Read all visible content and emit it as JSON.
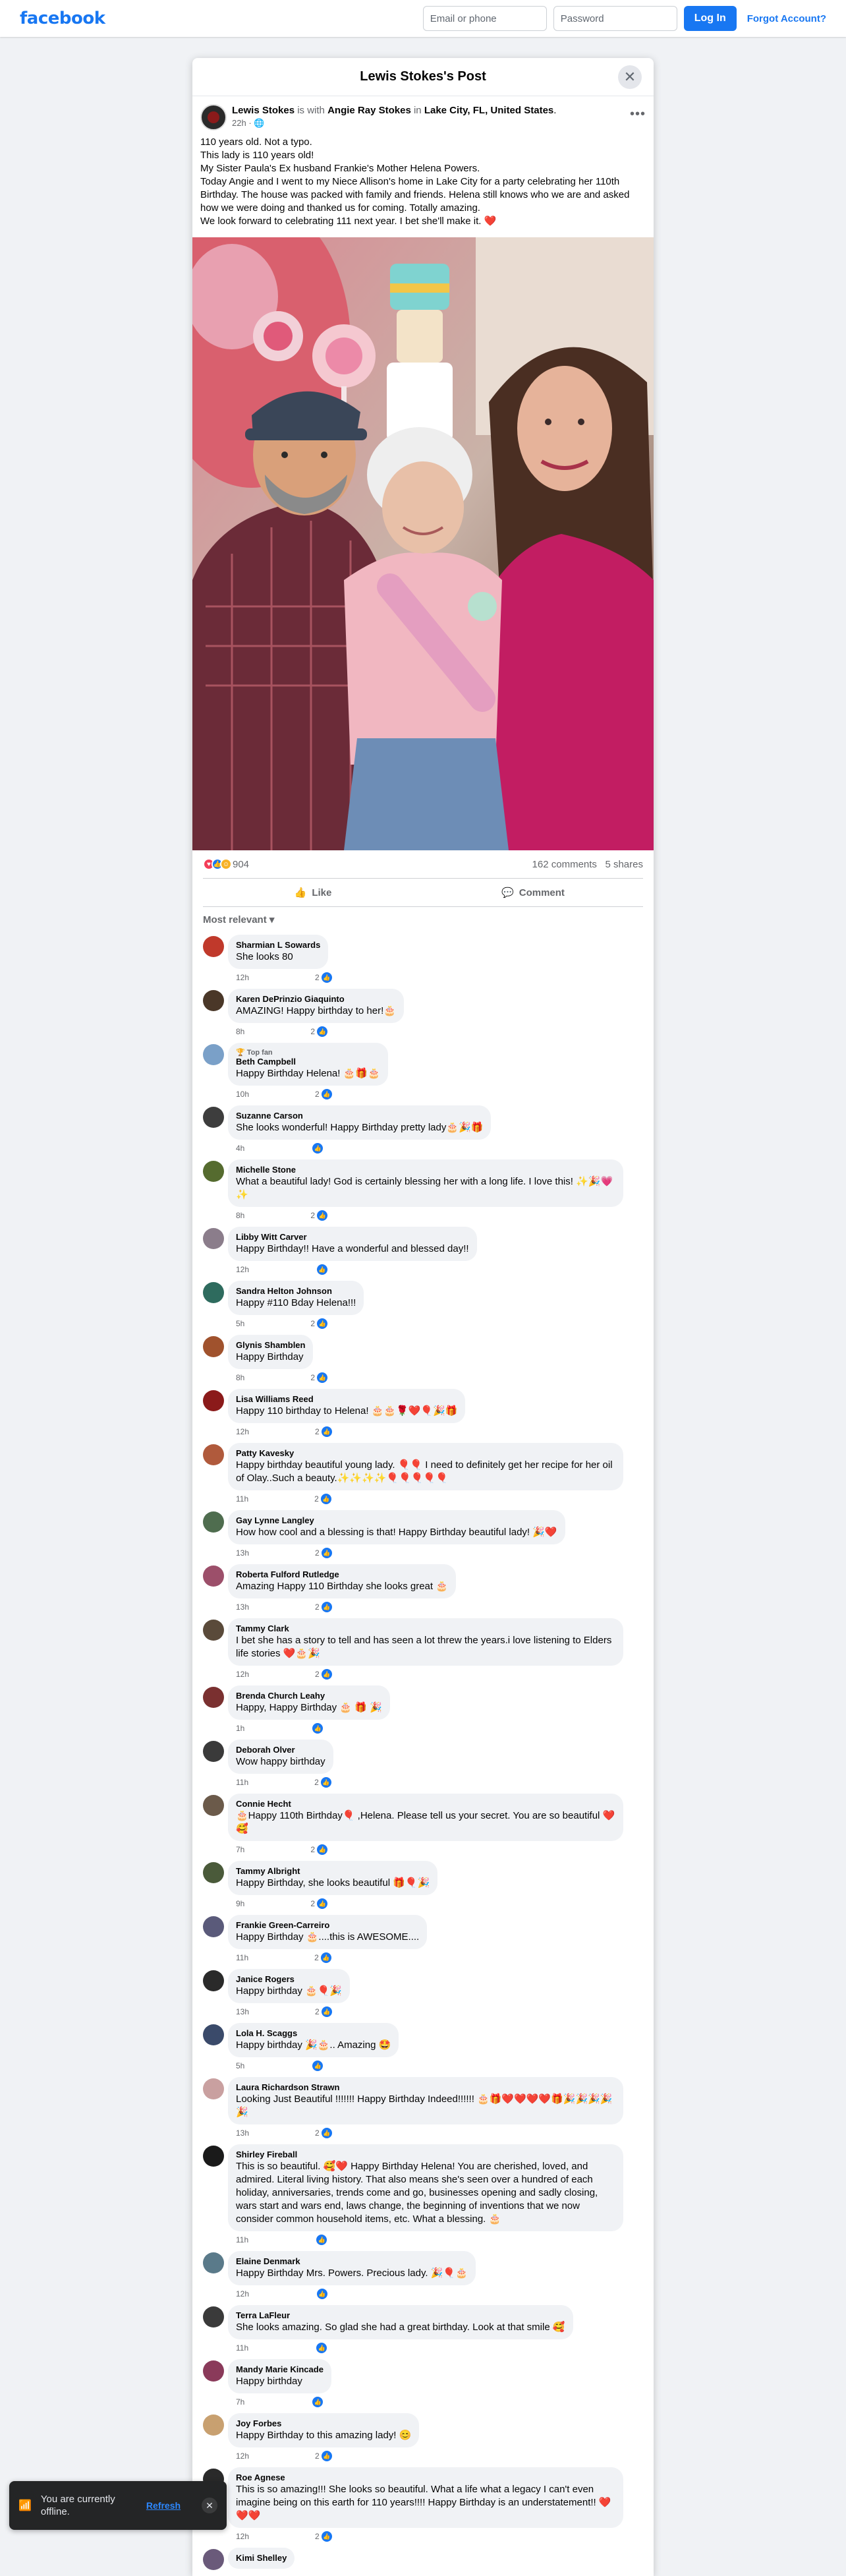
{
  "topbar": {
    "logo": "facebook",
    "email_placeholder": "Email or phone",
    "password_placeholder": "Password",
    "login_label": "Log In",
    "forgot_label": "Forgot Account?"
  },
  "modal": {
    "title": "Lewis Stokes's Post",
    "close_icon": "close-icon"
  },
  "post": {
    "author": "Lewis Stokes",
    "with_text": "is with",
    "tagged": "Angie Ray Stokes",
    "in_text": "in",
    "location": "Lake City, FL, United States",
    "end_punct": ".",
    "time": "22h",
    "privacy_icon": "globe-icon",
    "text_lines": [
      "110 years old. Not a typo.",
      "This lady is 110 years old!",
      "My Sister Paula's Ex husband Frankie's Mother Helena Powers.",
      "Today Angie and I went to my Niece Allison's home in Lake City for a party celebrating her 110th Birthday. The house was packed with family and friends. Helena still knows who we are and asked how we were doing and thanked us for coming.  Totally amazing.",
      "We look forward to celebrating 111 next year. I bet she'll make it. ❤️"
    ]
  },
  "stats": {
    "reaction_count": "904",
    "comments": "162 comments",
    "shares": "5 shares"
  },
  "actions": {
    "like": "Like",
    "comment": "Comment"
  },
  "sort_label": "Most relevant",
  "comments": [
    {
      "name": "Sharmian L Sowards",
      "text": "She looks 80",
      "time": "12h",
      "reacts": "2",
      "color": "#c0392b"
    },
    {
      "name": "Karen DePrinzio Giaquinto",
      "text": "AMAZING! Happy birthday to her!🎂",
      "time": "8h",
      "reacts": "2",
      "color": "#4a3728"
    },
    {
      "badge": "🏆 Top fan",
      "name": "Beth Campbell",
      "text": "Happy Birthday Helena! 🎂🎁🎂",
      "time": "10h",
      "reacts": "2",
      "color": "#7aa0c8"
    },
    {
      "name": "Suzanne Carson",
      "text": "She looks wonderful! Happy Birthday pretty lady🎂🎉🎁",
      "time": "4h",
      "reacts": "",
      "color": "#3d3d3d"
    },
    {
      "name": "Michelle Stone",
      "text": "What a beautiful lady! God is certainly blessing her with a long life. I love this! ✨🎉💗✨",
      "time": "8h",
      "reacts": "2",
      "color": "#556b2f"
    },
    {
      "name": "Libby Witt Carver",
      "text": "Happy Birthday!! Have a wonderful and blessed day!!",
      "time": "12h",
      "reacts": "",
      "color": "#8b7d8b"
    },
    {
      "name": "Sandra Helton Johnson",
      "text": "Happy #110 Bday Helena!!!",
      "time": "5h",
      "reacts": "2",
      "color": "#2e6b5e"
    },
    {
      "name": "Glynis Shamblen",
      "text": "Happy Birthday",
      "time": "8h",
      "reacts": "2",
      "color": "#a0522d"
    },
    {
      "name": "Lisa Williams Reed",
      "text": "Happy 110 birthday to Helena! 🎂🎂🌹❤️🎈🎉🎁",
      "time": "12h",
      "reacts": "2",
      "color": "#8b1a1a"
    },
    {
      "name": "Patty Kavesky",
      "text": "Happy birthday beautiful young lady. 🎈🎈 I need to definitely get her recipe for her oil of Olay..Such a beauty.✨✨✨✨🎈🎈🎈🎈🎈",
      "time": "11h",
      "reacts": "2",
      "color": "#b05a3c"
    },
    {
      "name": "Gay Lynne Langley",
      "text": "How how cool and a blessing is that! Happy Birthday beautiful lady! 🎉❤️",
      "time": "13h",
      "reacts": "2",
      "color": "#4f6d4f"
    },
    {
      "name": "Roberta Fulford Rutledge",
      "text": "Amazing Happy 110 Birthday she looks great 🎂",
      "time": "13h",
      "reacts": "2",
      "color": "#9c4f6a"
    },
    {
      "name": "Tammy Clark",
      "text": "I bet she has a story to tell and has seen a lot threw the years.i love listening to Elders life stories ❤️🎂🎉",
      "time": "12h",
      "reacts": "2",
      "color": "#5a4a3a"
    },
    {
      "name": "Brenda Church Leahy",
      "text": "Happy, Happy Birthday 🎂 🎁 🎉",
      "time": "1h",
      "reacts": "",
      "color": "#7a3030"
    },
    {
      "name": "Deborah Olver",
      "text": "Wow happy birthday",
      "time": "11h",
      "reacts": "2",
      "color": "#3a3a3a"
    },
    {
      "name": "Connie Hecht",
      "text": "🎂Happy 110th Birthday🎈 ,Helena. Please tell us your secret. You are so beautiful ❤️🥰",
      "time": "7h",
      "reacts": "2",
      "color": "#6b5a4a"
    },
    {
      "name": "Tammy Albright",
      "text": "Happy Birthday, she looks beautiful 🎁🎈🎉",
      "time": "9h",
      "reacts": "2",
      "color": "#4a5a3a"
    },
    {
      "name": "Frankie Green-Carreiro",
      "text": "Happy Birthday 🎂....this is AWESOME....",
      "time": "11h",
      "reacts": "2",
      "color": "#5a5a7a"
    },
    {
      "name": "Janice Rogers",
      "text": "Happy birthday 🎂🎈🎉",
      "time": "13h",
      "reacts": "2",
      "color": "#2a2a2a"
    },
    {
      "name": "Lola H. Scaggs",
      "text": "Happy birthday 🎉🎂.. Amazing 🤩",
      "time": "5h",
      "reacts": "",
      "color": "#3a4a6a"
    },
    {
      "name": "Laura Richardson Strawn",
      "text": "Looking Just Beautiful !!!!!!! Happy Birthday Indeed!!!!!! 🎂🎁❤️❤️❤️❤️🎁🎉🎉🎉🎉🎉",
      "time": "13h",
      "reacts": "2",
      "color": "#c9a0a0"
    },
    {
      "name": "Shirley Fireball",
      "text": "This is so beautiful. 🥰❤️ Happy Birthday Helena! You are cherished, loved, and admired. Literal living history. That also means she's seen over a hundred of each holiday, anniversaries, trends come and go, businesses opening and sadly closing, wars start and wars end, laws change, the beginning of inventions that we now consider common household items, etc. What a blessing. 🎂",
      "time": "11h",
      "reacts": "",
      "color": "#1a1a1a"
    },
    {
      "name": "Elaine Denmark",
      "text": "Happy Birthday Mrs. Powers. Precious lady. 🎉🎈🎂",
      "time": "12h",
      "reacts": "",
      "color": "#5a7a8a"
    },
    {
      "name": "Terra LaFleur",
      "text": "She looks amazing. So glad she had a great birthday. Look at that smile 🥰",
      "time": "11h",
      "reacts": "",
      "color": "#3a3a3a"
    },
    {
      "name": "Mandy Marie Kincade",
      "text": "Happy birthday",
      "time": "7h",
      "reacts": "",
      "color": "#8a3a5a"
    },
    {
      "name": "Joy Forbes",
      "text": "Happy Birthday to this amazing lady! 😊",
      "time": "12h",
      "reacts": "2",
      "color": "#c8a070"
    },
    {
      "name": "Roe Agnese",
      "text": "This is so amazing!!! She looks so beautiful. What a life what a legacy I can't even imagine being on this earth for 110 years!!!! Happy Birthday is an understatement!! ❤️❤️❤️",
      "time": "12h",
      "reacts": "2",
      "color": "#2a2a2a"
    },
    {
      "name": "Kimi Shelley",
      "text": "",
      "time": "",
      "reacts": "",
      "color": "#6a5a7a"
    }
  ],
  "offline": {
    "message": "You are currently offline.",
    "refresh": "Refresh",
    "wifi_icon": "wifi-off-icon",
    "close_icon": "close-icon"
  },
  "colors": {
    "brand": "#1877f2",
    "background": "#f0f2f5"
  }
}
